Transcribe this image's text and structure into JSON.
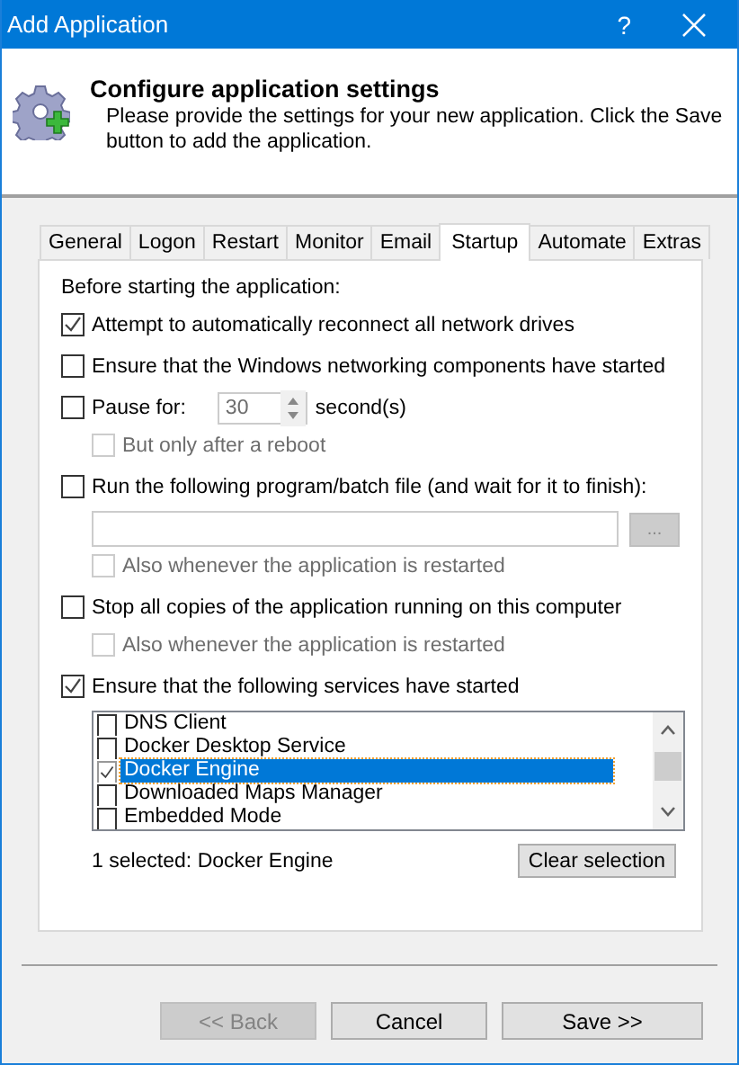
{
  "window": {
    "title": "Add Application",
    "help": "?"
  },
  "header": {
    "title": "Configure application settings",
    "description": "Please provide the settings for your new application. Click the Save button to add the application."
  },
  "tabs": [
    {
      "label": "General",
      "selected": false
    },
    {
      "label": "Logon",
      "selected": false
    },
    {
      "label": "Restart",
      "selected": false
    },
    {
      "label": "Monitor",
      "selected": false
    },
    {
      "label": "Email",
      "selected": false
    },
    {
      "label": "Startup",
      "selected": true
    },
    {
      "label": "Automate",
      "selected": false
    },
    {
      "label": "Extras",
      "selected": false
    }
  ],
  "startup": {
    "intro": "Before starting the application:",
    "options": [
      {
        "kind": "checkbox",
        "label": "Attempt to automatically reconnect all network drives",
        "checked": true
      },
      {
        "kind": "checkbox",
        "label": "Ensure that the Windows networking components have started",
        "checked": false
      },
      {
        "kind": "pause",
        "label": "Pause for:",
        "checked": false,
        "value": "30",
        "unit": "second(s)",
        "children": [
          {
            "label": "But only after a reboot",
            "checked": false,
            "disabled": true
          }
        ]
      },
      {
        "kind": "file",
        "label": "Run the following program/batch file (and wait for it to finish):",
        "checked": false,
        "browse": "...",
        "children": [
          {
            "label": "Also whenever the application is restarted",
            "checked": false,
            "disabled": true
          }
        ]
      },
      {
        "kind": "checkbox",
        "label": "Stop all copies of the application running on this computer",
        "checked": false,
        "children": [
          {
            "label": "Also whenever the application is restarted",
            "checked": false,
            "disabled": true
          }
        ]
      },
      {
        "kind": "services",
        "label": "Ensure that the following services have started",
        "checked": true,
        "services": [
          {
            "name": "DNS Client",
            "checked": false,
            "selected": false
          },
          {
            "name": "Docker Desktop Service",
            "checked": false,
            "selected": false
          },
          {
            "name": "Docker Engine",
            "checked": true,
            "selected": true
          },
          {
            "name": "Downloaded Maps Manager",
            "checked": false,
            "selected": false
          },
          {
            "name": "Embedded Mode",
            "checked": false,
            "selected": false
          }
        ],
        "summary": "1 selected: Docker Engine",
        "clear_button": "Clear selection"
      }
    ]
  },
  "footer": {
    "buttons": [
      {
        "label": "<< Back",
        "disabled": true
      },
      {
        "label": "Cancel",
        "disabled": false
      },
      {
        "label": "Save >>",
        "disabled": false
      }
    ]
  }
}
